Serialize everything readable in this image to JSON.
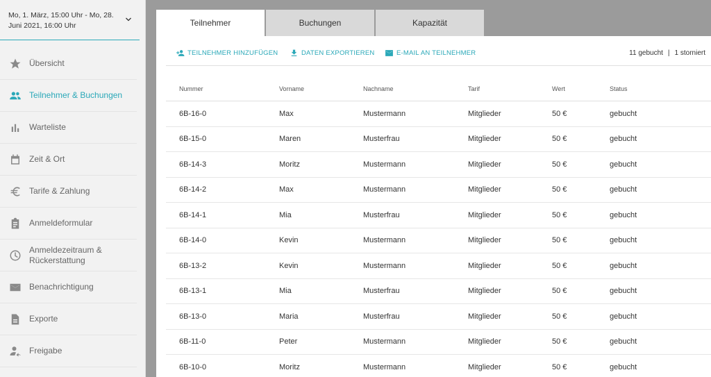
{
  "sidebar": {
    "date_range": "Mo, 1. März, 15:00 Uhr - Mo, 28. Juni 2021, 16:00 Uhr",
    "items": [
      {
        "label": "Übersicht",
        "icon": "star-icon"
      },
      {
        "label": "Teilnehmer & Buchungen",
        "icon": "people-icon"
      },
      {
        "label": "Warteliste",
        "icon": "bar-chart-icon"
      },
      {
        "label": "Zeit & Ort",
        "icon": "calendar-icon"
      },
      {
        "label": "Tarife & Zahlung",
        "icon": "euro-icon"
      },
      {
        "label": "Anmeldeformular",
        "icon": "clipboard-icon"
      },
      {
        "label": "Anmeldezeitraum & Rückerstattung",
        "icon": "clock-icon"
      },
      {
        "label": "Benachrichtigung",
        "icon": "mail-icon"
      },
      {
        "label": "Exporte",
        "icon": "document-icon"
      },
      {
        "label": "Freigabe",
        "icon": "person-share-icon"
      }
    ],
    "active_index": 1
  },
  "tabs": [
    {
      "label": "Teilnehmer",
      "active": true
    },
    {
      "label": "Buchungen",
      "active": false
    },
    {
      "label": "Kapazität",
      "active": false
    }
  ],
  "toolbar": {
    "add_label": "TEILNEHMER HINZUFÜGEN",
    "export_label": "DATEN EXPORTIEREN",
    "email_label": "E-MAIL AN TEILNEHMER",
    "booked": "11 gebucht",
    "separator": "|",
    "cancelled": "1 storniert"
  },
  "table": {
    "headers": [
      "Nummer",
      "Vorname",
      "Nachname",
      "Tarif",
      "Wert",
      "Status"
    ],
    "rows": [
      [
        "6B-16-0",
        "Max",
        "Mustermann",
        "Mitglieder",
        "50 €",
        "gebucht"
      ],
      [
        "6B-15-0",
        "Maren",
        "Musterfrau",
        "Mitglieder",
        "50 €",
        "gebucht"
      ],
      [
        "6B-14-3",
        "Moritz",
        "Mustermann",
        "Mitglieder",
        "50 €",
        "gebucht"
      ],
      [
        "6B-14-2",
        "Max",
        "Mustermann",
        "Mitglieder",
        "50 €",
        "gebucht"
      ],
      [
        "6B-14-1",
        "Mia",
        "Musterfrau",
        "Mitglieder",
        "50 €",
        "gebucht"
      ],
      [
        "6B-14-0",
        "Kevin",
        "Mustermann",
        "Mitglieder",
        "50 €",
        "gebucht"
      ],
      [
        "6B-13-2",
        "Kevin",
        "Mustermann",
        "Mitglieder",
        "50 €",
        "gebucht"
      ],
      [
        "6B-13-1",
        "Mia",
        "Musterfrau",
        "Mitglieder",
        "50 €",
        "gebucht"
      ],
      [
        "6B-13-0",
        "Maria",
        "Musterfrau",
        "Mitglieder",
        "50 €",
        "gebucht"
      ],
      [
        "6B-11-0",
        "Peter",
        "Mustermann",
        "Mitglieder",
        "50 €",
        "gebucht"
      ],
      [
        "6B-10-0",
        "Moritz",
        "Mustermann",
        "Mitglieder",
        "50 €",
        "gebucht"
      ]
    ]
  },
  "colors": {
    "accent": "#2aa8b8",
    "background": "#9b9b9b",
    "sidebar_bg": "#f2f2f2",
    "tab_inactive": "#d9d9d9"
  }
}
